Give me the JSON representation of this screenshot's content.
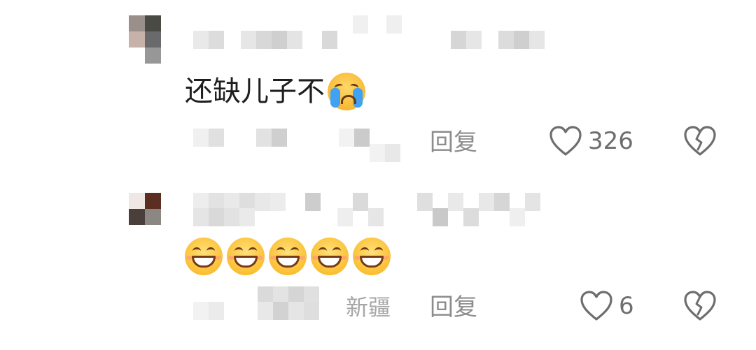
{
  "comments": [
    {
      "text": "还缺儿子不",
      "emoji": "loudly-crying-face",
      "reply_label": "回复",
      "like_count": "326",
      "location": ""
    },
    {
      "text": "",
      "emoji": "grinning-face-with-smiling-eyes",
      "emoji_count": 5,
      "reply_label": "回复",
      "like_count": "6",
      "location": "新疆"
    }
  ],
  "colors": {
    "text": "#1e1e1e",
    "meta": "#8c8c8c",
    "location": "#a6a6a6",
    "icon_stroke": "#6e6e6e"
  }
}
